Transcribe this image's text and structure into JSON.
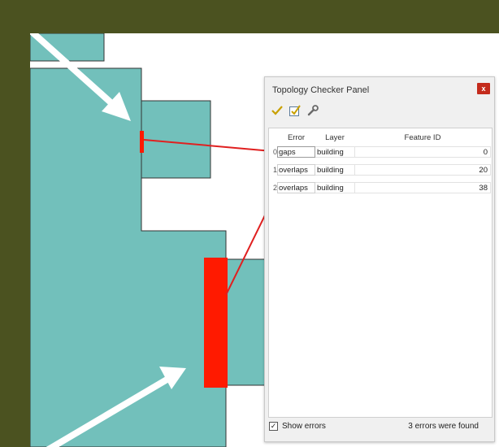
{
  "colors": {
    "background": "#4b5220",
    "building_fill": "#72c0bb",
    "error_highlight": "#ff1a00",
    "arrow": "#ffffff"
  },
  "map": {
    "layer": "building",
    "errors_highlighted": [
      "gaps",
      "overlaps"
    ]
  },
  "panel": {
    "title": "Topology Checker Panel",
    "close_icon": "close-icon",
    "toolbar": [
      {
        "name": "validate-all",
        "icon": "checkmark-icon"
      },
      {
        "name": "validate-extent",
        "icon": "checklist-icon"
      },
      {
        "name": "configure-rules",
        "icon": "wrench-icon"
      }
    ],
    "columns": [
      "Error",
      "Layer",
      "Feature ID"
    ],
    "rows": [
      {
        "index": "0",
        "error": "gaps",
        "layer": "building",
        "feature_id": "0"
      },
      {
        "index": "1",
        "error": "overlaps",
        "layer": "building",
        "feature_id": "20"
      },
      {
        "index": "2",
        "error": "overlaps",
        "layer": "building",
        "feature_id": "38"
      }
    ],
    "show_errors_label": "Show errors",
    "show_errors_checked": true,
    "status": "3 errors were found"
  }
}
